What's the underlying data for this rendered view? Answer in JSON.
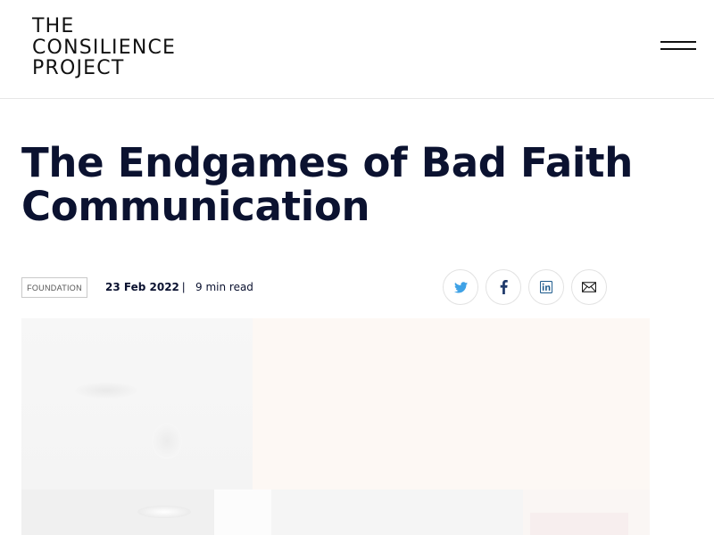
{
  "header": {
    "logo_lines": [
      "THE",
      "CONSILIENCE",
      "PROJECT"
    ],
    "menu_icon": "hamburger-menu-icon"
  },
  "article": {
    "title_lines": [
      "The Endgames of Bad Faith",
      "Communication"
    ],
    "category": "FOUNDATION",
    "date": "23 Feb 2022",
    "separator": "|",
    "read_time": "9 min read"
  },
  "share": {
    "icons": [
      "twitter-icon",
      "facebook-icon",
      "linkedin-icon",
      "mail-icon"
    ],
    "colors": {
      "twitter": "#3fa2e6",
      "facebook": "#1f3a6b",
      "linkedin": "#1d5a8c",
      "mail": "#1a1a1a"
    }
  },
  "colors": {
    "title": "#0b1230",
    "divider": "#e6e6e6"
  }
}
